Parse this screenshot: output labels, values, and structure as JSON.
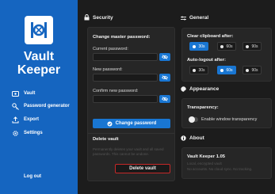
{
  "app": {
    "title_line1": "Vault",
    "title_line2": "Keeper"
  },
  "sidebar": {
    "items": [
      {
        "label": "Vault"
      },
      {
        "label": "Password generator"
      },
      {
        "label": "Export"
      },
      {
        "label": "Settings"
      }
    ],
    "logout_label": "Log out"
  },
  "security": {
    "title": "Security",
    "change_heading": "Change master password:",
    "current_label": "Current password:",
    "new_label": "New password:",
    "confirm_label": "Confirm new password:",
    "change_button": "Change password",
    "delete_heading": "Delete vault",
    "delete_description": "Permanently deletes your vault and all saved passwords. This cannot be undone.",
    "delete_button": "Delete vault"
  },
  "general": {
    "title": "General",
    "clear_label": "Clear clipboard after:",
    "clear_options": [
      "30s",
      "60s",
      "90s"
    ],
    "clear_selected": "30s",
    "autolock_label": "Auto-logout after:",
    "autolock_options": [
      "30s",
      "60s",
      "90s"
    ],
    "autolock_selected": "60s"
  },
  "appearance": {
    "title": "Appearance",
    "transparency_label": "Transparency:",
    "toggle_label": "Enable window transparency",
    "toggle_on": false
  },
  "about": {
    "title": "About",
    "name": "Vault Keeper 1.05",
    "line1": "Local, encrypted vault",
    "line2": "No accounts. No cloud sync. No tracking."
  },
  "colors": {
    "accent": "#1976d2",
    "sidebar": "#1565c0",
    "danger": "#c62828",
    "background": "#1c1c1c"
  }
}
